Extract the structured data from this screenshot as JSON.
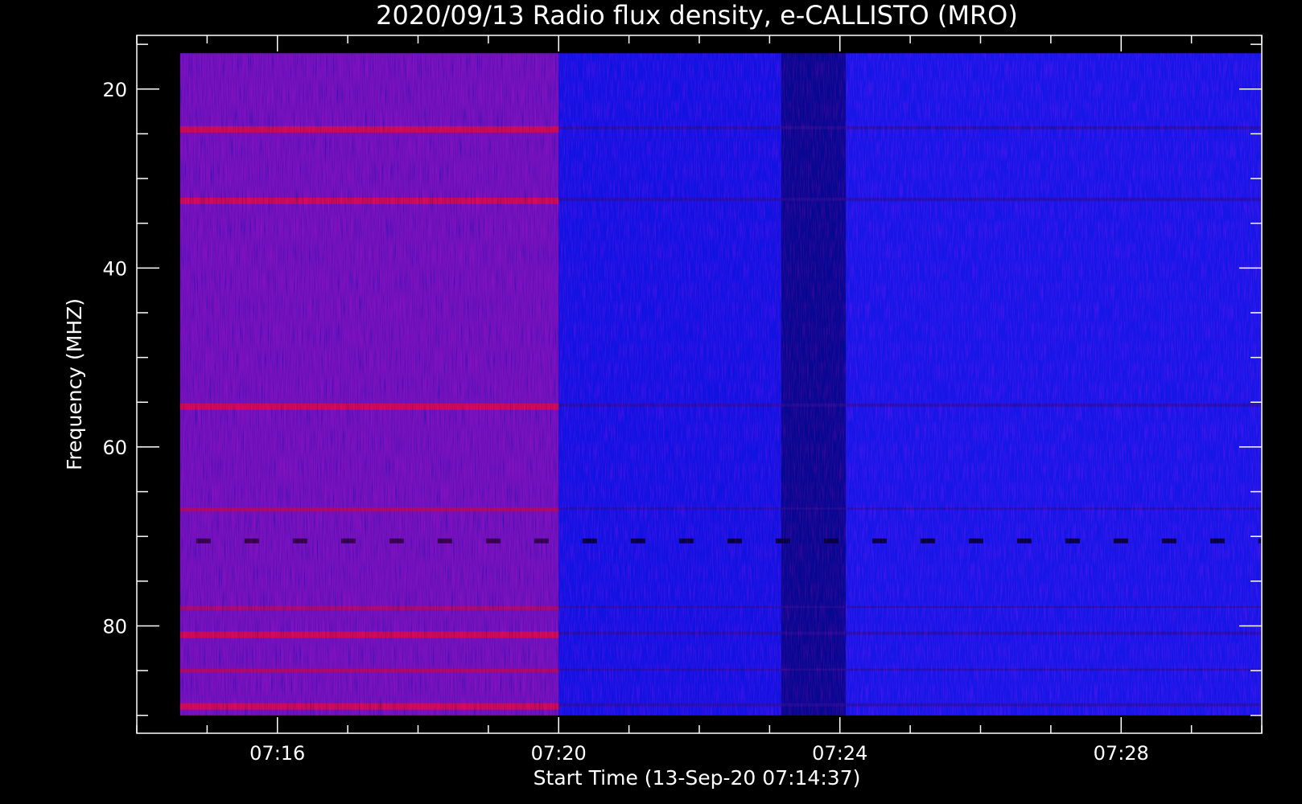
{
  "chart_data": {
    "type": "heatmap",
    "title": "2020/09/13  Radio flux density, e-CALLISTO (MRO)",
    "xlabel": "Start Time (13-Sep-20 07:14:37)",
    "ylabel": "Frequency (MHZ)",
    "x_unit": "UT time",
    "x_range": [
      "07:14:37",
      "07:30:00"
    ],
    "x_axis_limits": [
      "07:14:00",
      "07:30:00"
    ],
    "x_major_ticks": [
      "07:16",
      "07:20",
      "07:24",
      "07:28"
    ],
    "x_minor_tick_step_minutes": 1,
    "y_range": [
      16,
      90
    ],
    "y_axis_limits": [
      14,
      92
    ],
    "y_inverted": true,
    "y_major_ticks": [
      20,
      40,
      60,
      80
    ],
    "y_minor_tick_step": 5,
    "colormap": {
      "low": "#000000",
      "mid": "#1010ff",
      "high": "#ff0000"
    },
    "segments": [
      {
        "start": "07:14:37",
        "end": "07:20:00",
        "level": "elevated",
        "color": "#5a1aa8"
      },
      {
        "start": "07:20:00",
        "end": "07:23:10",
        "level": "low",
        "color": "#1a1ae0"
      },
      {
        "start": "07:23:10",
        "end": "07:24:05",
        "level": "very low",
        "color": "#0a0a70"
      },
      {
        "start": "07:24:05",
        "end": "07:30:00",
        "level": "low",
        "color": "#2020e8"
      }
    ],
    "emission_bands_mhz": [
      {
        "frequency": 24.5,
        "strength": "strong"
      },
      {
        "frequency": 32.5,
        "strength": "strong"
      },
      {
        "frequency": 55.5,
        "strength": "strong"
      },
      {
        "frequency": 67,
        "strength": "medium"
      },
      {
        "frequency": 70.5,
        "strength": "gaps"
      },
      {
        "frequency": 78,
        "strength": "medium"
      },
      {
        "frequency": 81,
        "strength": "strong"
      },
      {
        "frequency": 85,
        "strength": "medium"
      },
      {
        "frequency": 89,
        "strength": "strong"
      }
    ],
    "grid": false,
    "legend": "none"
  }
}
